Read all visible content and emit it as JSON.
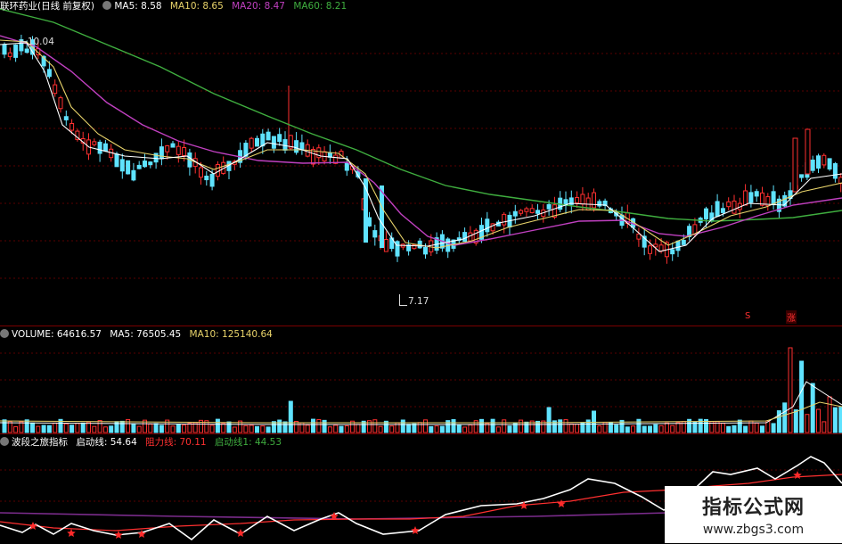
{
  "price": {
    "legend": {
      "title": "联环药业(日线 前复权)",
      "ma5": "MA5: 8.58",
      "ma10": "MA10: 8.65",
      "ma20": "MA20: 8.47",
      "ma60": "MA60: 8.21"
    },
    "high_label": "10.04",
    "low_label": "7.17",
    "markers": {
      "m1": "S",
      "m2": "涨"
    },
    "colors": {
      "ma5": "#ffffff",
      "ma10": "#e8d36a",
      "ma20": "#c040c0",
      "ma60": "#3fae3f",
      "up": "#ff3030",
      "down": "#5fe3ff"
    }
  },
  "volume": {
    "legend": {
      "title": "VOLUME: 64616.57",
      "ma5": "MA5: 76505.45",
      "ma10": "MA10: 125140.64"
    }
  },
  "indicator": {
    "legend": {
      "title": "波段之旅指标",
      "qidong": "启动线: 54.64",
      "zuli": "阻力线: 70.11",
      "qidong1": "启动线1: 44.53"
    },
    "colors": {
      "qidong": "#ffffff",
      "zuli": "#ff3030",
      "qidong1": "#3fae3f",
      "star": "#ff2a2a",
      "baseline": "#7b2c8c"
    }
  },
  "watermark": {
    "name": "指标公式网",
    "url": "www.zbgs3.com"
  }
}
